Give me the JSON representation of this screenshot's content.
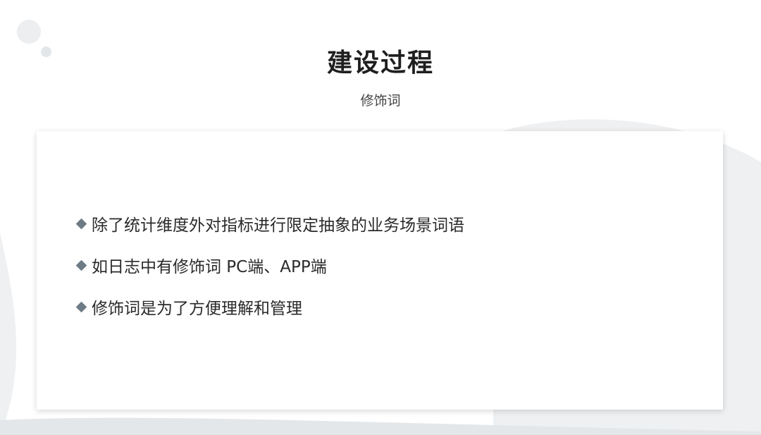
{
  "slide": {
    "title": "建设过程",
    "subtitle": "修饰词",
    "bullets": [
      "除了统计维度外对指标进行限定抽象的业务场景词语",
      "如日志中有修饰词 PC端、APP端",
      "修饰词是为了方便理解和管理"
    ],
    "bullet_icon": "diamond-icon",
    "colors": {
      "background": "#ffffff",
      "decoration": "#eceef0",
      "bullet_icon": "#6d7b84",
      "title": "#1f1f1f",
      "body_text": "#2a2a2a"
    }
  }
}
